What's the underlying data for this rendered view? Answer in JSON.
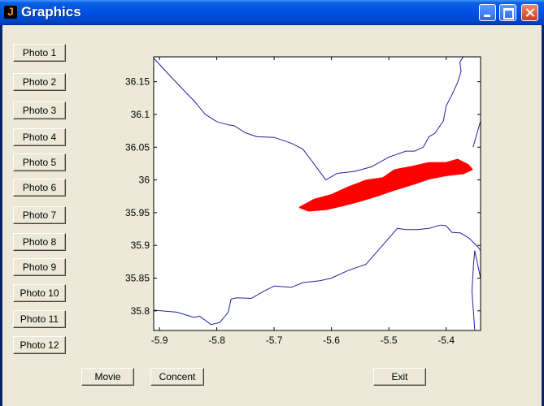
{
  "window": {
    "title": "Graphics",
    "icon": "matlab-icon"
  },
  "photo_buttons": [
    "Photo 1",
    "Photo 2",
    "Photo 3",
    "Photo 4",
    "Photo 5",
    "Photo 6",
    "Photo 7",
    "Photo 8",
    "Photo 9",
    "Photo 10",
    "Photo 11",
    "Photo 12"
  ],
  "bottom_buttons": {
    "movie": "Movie",
    "concent": "Concent",
    "exit": "Exit"
  },
  "chart_data": {
    "type": "scatter",
    "title": "",
    "xlabel": "",
    "ylabel": "",
    "xlim": [
      -5.91,
      -5.34
    ],
    "ylim": [
      35.77,
      36.188
    ],
    "xticks": [
      -5.9,
      -5.8,
      -5.7,
      -5.6,
      -5.5,
      -5.4
    ],
    "xtick_labels": [
      "-5.9",
      "-5.8",
      "-5.7",
      "-5.6",
      "-5.5",
      "-5.4"
    ],
    "yticks": [
      35.8,
      35.85,
      35.9,
      35.95,
      36.0,
      36.05,
      36.1,
      36.15
    ],
    "ytick_labels": [
      "35.8",
      "35.85",
      "35.9",
      "35.95",
      "36",
      "36.05",
      "36.1",
      "36.15"
    ],
    "coast_color": "#2020a0",
    "slick_color": "#ff0000",
    "coastline_north": [
      [
        -5.91,
        36.186
      ],
      [
        -5.89,
        36.167
      ],
      [
        -5.86,
        36.139
      ],
      [
        -5.84,
        36.121
      ],
      [
        -5.82,
        36.1
      ],
      [
        -5.8,
        36.089
      ],
      [
        -5.78,
        36.084
      ],
      [
        -5.77,
        36.083
      ],
      [
        -5.75,
        36.072
      ],
      [
        -5.73,
        36.066
      ],
      [
        -5.7,
        36.065
      ],
      [
        -5.67,
        36.056
      ],
      [
        -5.65,
        36.047
      ],
      [
        -5.63,
        36.024
      ],
      [
        -5.61,
        36.0
      ],
      [
        -5.59,
        36.01
      ],
      [
        -5.56,
        36.013
      ],
      [
        -5.53,
        36.02
      ],
      [
        -5.5,
        36.035
      ],
      [
        -5.47,
        36.044
      ],
      [
        -5.455,
        36.044
      ],
      [
        -5.44,
        36.05
      ],
      [
        -5.43,
        36.066
      ],
      [
        -5.42,
        36.071
      ],
      [
        -5.405,
        36.09
      ],
      [
        -5.4,
        36.113
      ],
      [
        -5.39,
        36.13
      ],
      [
        -5.38,
        36.149
      ],
      [
        -5.374,
        36.166
      ],
      [
        -5.376,
        36.18
      ],
      [
        -5.37,
        36.188
      ]
    ],
    "coastline_east": [
      [
        -5.353,
        36.05
      ],
      [
        -5.345,
        36.075
      ],
      [
        -5.34,
        36.09
      ]
    ],
    "coastline_south": [
      [
        -5.91,
        35.801
      ],
      [
        -5.87,
        35.798
      ],
      [
        -5.84,
        35.79
      ],
      [
        -5.83,
        35.792
      ],
      [
        -5.81,
        35.779
      ],
      [
        -5.795,
        35.782
      ],
      [
        -5.78,
        35.798
      ],
      [
        -5.775,
        35.818
      ],
      [
        -5.765,
        35.82
      ],
      [
        -5.74,
        35.819
      ],
      [
        -5.72,
        35.829
      ],
      [
        -5.7,
        35.838
      ],
      [
        -5.67,
        35.836
      ],
      [
        -5.65,
        35.843
      ],
      [
        -5.62,
        35.846
      ],
      [
        -5.6,
        35.85
      ],
      [
        -5.57,
        35.862
      ],
      [
        -5.54,
        35.871
      ],
      [
        -5.52,
        35.891
      ],
      [
        -5.5,
        35.911
      ],
      [
        -5.485,
        35.926
      ],
      [
        -5.47,
        35.924
      ],
      [
        -5.45,
        35.924
      ],
      [
        -5.43,
        35.926
      ],
      [
        -5.41,
        35.931
      ],
      [
        -5.4,
        35.93
      ],
      [
        -5.39,
        35.92
      ],
      [
        -5.375,
        35.919
      ],
      [
        -5.36,
        35.911
      ],
      [
        -5.345,
        35.898
      ],
      [
        -5.34,
        35.892
      ]
    ],
    "coastline_ceuta": [
      [
        -5.34,
        35.85
      ],
      [
        -5.345,
        35.87
      ],
      [
        -5.35,
        35.892
      ],
      [
        -5.352,
        35.874
      ],
      [
        -5.355,
        35.83
      ],
      [
        -5.35,
        35.77
      ]
    ],
    "oil_slick_polygon": [
      [
        -5.655,
        35.958
      ],
      [
        -5.63,
        35.97
      ],
      [
        -5.6,
        35.977
      ],
      [
        -5.57,
        35.989
      ],
      [
        -5.54,
        35.999
      ],
      [
        -5.51,
        36.003
      ],
      [
        -5.49,
        36.015
      ],
      [
        -5.46,
        36.02
      ],
      [
        -5.43,
        36.026
      ],
      [
        -5.4,
        36.026
      ],
      [
        -5.38,
        36.031
      ],
      [
        -5.362,
        36.023
      ],
      [
        -5.355,
        36.016
      ],
      [
        -5.37,
        36.01
      ],
      [
        -5.4,
        36.007
      ],
      [
        -5.43,
        36.002
      ],
      [
        -5.46,
        35.993
      ],
      [
        -5.49,
        35.985
      ],
      [
        -5.52,
        35.976
      ],
      [
        -5.55,
        35.968
      ],
      [
        -5.58,
        35.961
      ],
      [
        -5.61,
        35.955
      ],
      [
        -5.64,
        35.953
      ]
    ]
  }
}
